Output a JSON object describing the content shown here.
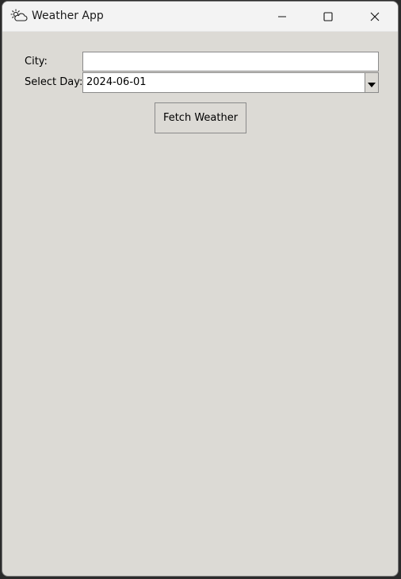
{
  "window": {
    "title": "Weather App",
    "icon": "partly-cloudy-icon",
    "controls": {
      "minimize": "minimize-icon",
      "maximize": "maximize-icon",
      "close": "close-icon"
    }
  },
  "form": {
    "city_label": "City:",
    "city_value": "",
    "day_label": "Select Day:",
    "day_value": "2024-06-01",
    "day_dropdown_icon": "chevron-down-icon",
    "fetch_label": "Fetch Weather"
  },
  "colors": {
    "window_bg": "#dcdad5",
    "titlebar_bg": "#f3f3f3",
    "input_bg": "#ffffff",
    "border": "#8a8a8a"
  }
}
